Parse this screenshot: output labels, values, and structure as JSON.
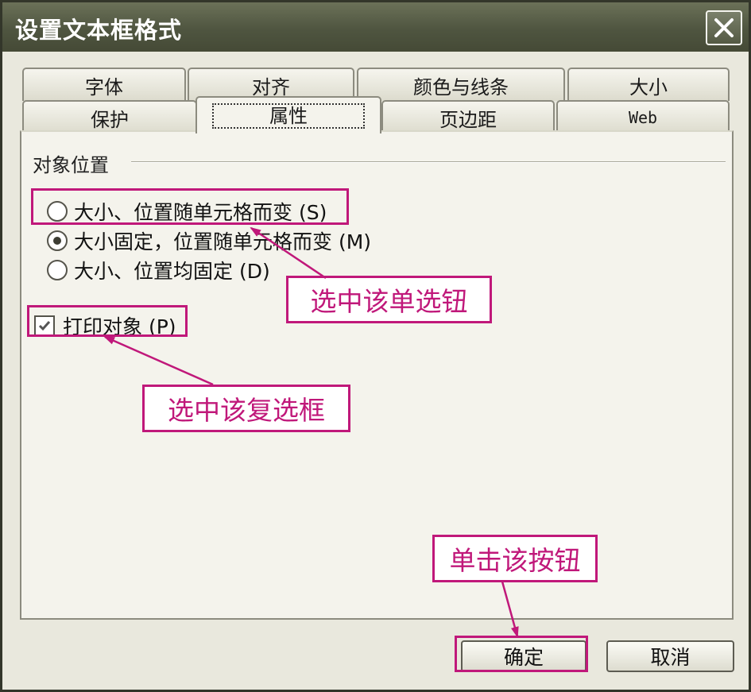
{
  "window": {
    "title": "设置文本框格式",
    "close_icon": "close-icon"
  },
  "tabs": {
    "row1": [
      "字体",
      "对齐",
      "颜色与线条",
      "大小"
    ],
    "row2": [
      "保护",
      "属性",
      "页边距",
      "Web"
    ],
    "active": "属性"
  },
  "panel": {
    "group_title": "对象位置",
    "options": [
      {
        "label": "大小、位置随单元格而变 (S)",
        "checked": false
      },
      {
        "label": "大小固定，位置随单元格而变 (M)",
        "checked": true
      },
      {
        "label": "大小、位置均固定 (D)",
        "checked": false
      }
    ],
    "print_object": {
      "label": "打印对象 (P)",
      "checked": true
    }
  },
  "annotations": {
    "radio_callout": "选中该单选钮",
    "checkbox_callout": "选中该复选框",
    "button_callout": "单击该按钮",
    "color": "#c0187a"
  },
  "buttons": {
    "ok": "确定",
    "cancel": "取消"
  }
}
